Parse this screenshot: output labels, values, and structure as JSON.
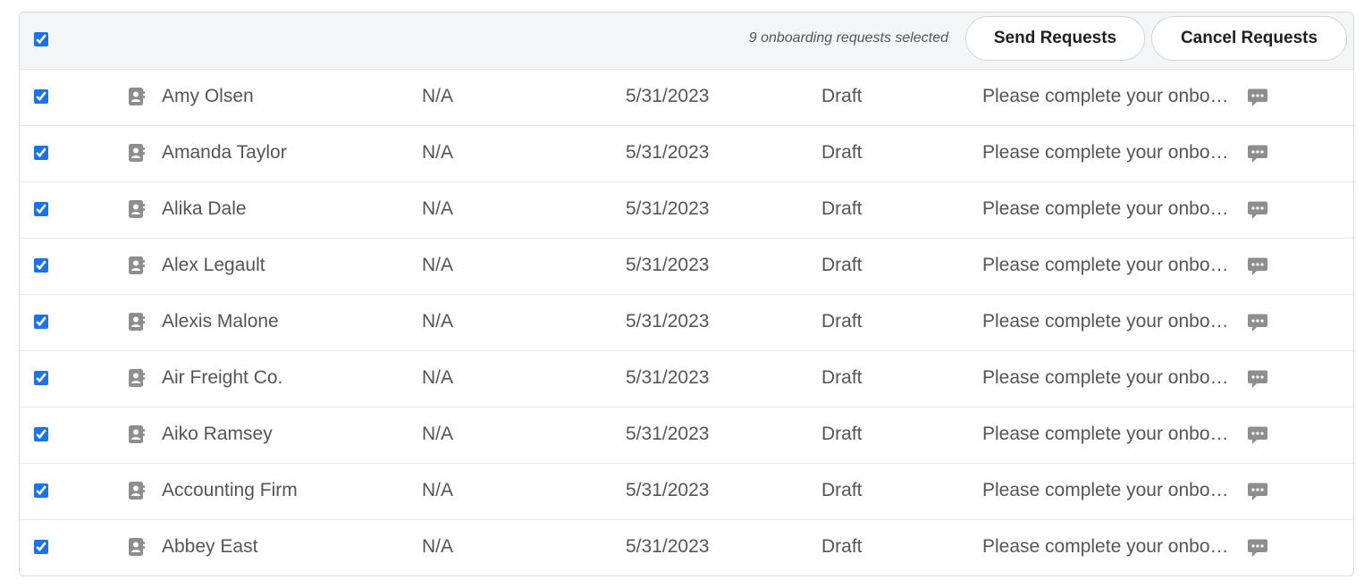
{
  "header": {
    "select_all_checked": true,
    "selection_text": "9 onboarding requests selected",
    "send_label": "Send Requests",
    "cancel_label": "Cancel Requests"
  },
  "icons": {
    "contact": "contact-card-icon",
    "message": "chat-bubble-icon"
  },
  "colors": {
    "checkbox": "#1a73e8",
    "icon": "#8e8e8e",
    "header_bg": "#f4f5f7"
  },
  "rows": [
    {
      "checked": true,
      "name": "Amy Olsen",
      "col2": "N/A",
      "date": "5/31/2023",
      "status": "Draft",
      "message": "Please complete your onbo…"
    },
    {
      "checked": true,
      "name": "Amanda Taylor",
      "col2": "N/A",
      "date": "5/31/2023",
      "status": "Draft",
      "message": "Please complete your onbo…"
    },
    {
      "checked": true,
      "name": "Alika Dale",
      "col2": "N/A",
      "date": "5/31/2023",
      "status": "Draft",
      "message": "Please complete your onbo…"
    },
    {
      "checked": true,
      "name": "Alex Legault",
      "col2": "N/A",
      "date": "5/31/2023",
      "status": "Draft",
      "message": "Please complete your onbo…"
    },
    {
      "checked": true,
      "name": "Alexis Malone",
      "col2": "N/A",
      "date": "5/31/2023",
      "status": "Draft",
      "message": "Please complete your onbo…"
    },
    {
      "checked": true,
      "name": "Air Freight Co.",
      "col2": "N/A",
      "date": "5/31/2023",
      "status": "Draft",
      "message": "Please complete your onbo…"
    },
    {
      "checked": true,
      "name": "Aiko Ramsey",
      "col2": "N/A",
      "date": "5/31/2023",
      "status": "Draft",
      "message": "Please complete your onbo…"
    },
    {
      "checked": true,
      "name": "Accounting Firm",
      "col2": "N/A",
      "date": "5/31/2023",
      "status": "Draft",
      "message": "Please complete your onbo…"
    },
    {
      "checked": true,
      "name": "Abbey East",
      "col2": "N/A",
      "date": "5/31/2023",
      "status": "Draft",
      "message": "Please complete your onbo…"
    }
  ]
}
